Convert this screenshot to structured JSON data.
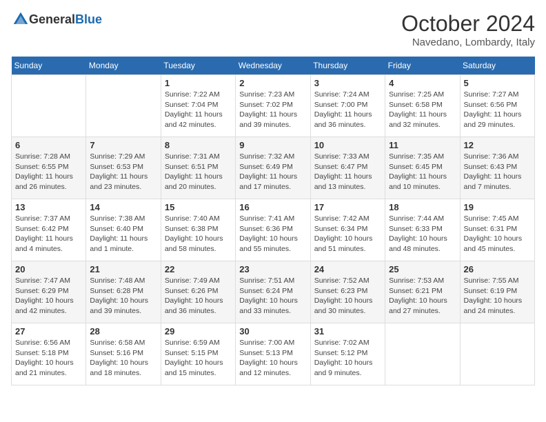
{
  "header": {
    "logo_general": "General",
    "logo_blue": "Blue",
    "month": "October 2024",
    "location": "Navedano, Lombardy, Italy"
  },
  "days_of_week": [
    "Sunday",
    "Monday",
    "Tuesday",
    "Wednesday",
    "Thursday",
    "Friday",
    "Saturday"
  ],
  "weeks": [
    [
      {
        "day": "",
        "info": ""
      },
      {
        "day": "",
        "info": ""
      },
      {
        "day": "1",
        "info": "Sunrise: 7:22 AM\nSunset: 7:04 PM\nDaylight: 11 hours and 42 minutes."
      },
      {
        "day": "2",
        "info": "Sunrise: 7:23 AM\nSunset: 7:02 PM\nDaylight: 11 hours and 39 minutes."
      },
      {
        "day": "3",
        "info": "Sunrise: 7:24 AM\nSunset: 7:00 PM\nDaylight: 11 hours and 36 minutes."
      },
      {
        "day": "4",
        "info": "Sunrise: 7:25 AM\nSunset: 6:58 PM\nDaylight: 11 hours and 32 minutes."
      },
      {
        "day": "5",
        "info": "Sunrise: 7:27 AM\nSunset: 6:56 PM\nDaylight: 11 hours and 29 minutes."
      }
    ],
    [
      {
        "day": "6",
        "info": "Sunrise: 7:28 AM\nSunset: 6:55 PM\nDaylight: 11 hours and 26 minutes."
      },
      {
        "day": "7",
        "info": "Sunrise: 7:29 AM\nSunset: 6:53 PM\nDaylight: 11 hours and 23 minutes."
      },
      {
        "day": "8",
        "info": "Sunrise: 7:31 AM\nSunset: 6:51 PM\nDaylight: 11 hours and 20 minutes."
      },
      {
        "day": "9",
        "info": "Sunrise: 7:32 AM\nSunset: 6:49 PM\nDaylight: 11 hours and 17 minutes."
      },
      {
        "day": "10",
        "info": "Sunrise: 7:33 AM\nSunset: 6:47 PM\nDaylight: 11 hours and 13 minutes."
      },
      {
        "day": "11",
        "info": "Sunrise: 7:35 AM\nSunset: 6:45 PM\nDaylight: 11 hours and 10 minutes."
      },
      {
        "day": "12",
        "info": "Sunrise: 7:36 AM\nSunset: 6:43 PM\nDaylight: 11 hours and 7 minutes."
      }
    ],
    [
      {
        "day": "13",
        "info": "Sunrise: 7:37 AM\nSunset: 6:42 PM\nDaylight: 11 hours and 4 minutes."
      },
      {
        "day": "14",
        "info": "Sunrise: 7:38 AM\nSunset: 6:40 PM\nDaylight: 11 hours and 1 minute."
      },
      {
        "day": "15",
        "info": "Sunrise: 7:40 AM\nSunset: 6:38 PM\nDaylight: 10 hours and 58 minutes."
      },
      {
        "day": "16",
        "info": "Sunrise: 7:41 AM\nSunset: 6:36 PM\nDaylight: 10 hours and 55 minutes."
      },
      {
        "day": "17",
        "info": "Sunrise: 7:42 AM\nSunset: 6:34 PM\nDaylight: 10 hours and 51 minutes."
      },
      {
        "day": "18",
        "info": "Sunrise: 7:44 AM\nSunset: 6:33 PM\nDaylight: 10 hours and 48 minutes."
      },
      {
        "day": "19",
        "info": "Sunrise: 7:45 AM\nSunset: 6:31 PM\nDaylight: 10 hours and 45 minutes."
      }
    ],
    [
      {
        "day": "20",
        "info": "Sunrise: 7:47 AM\nSunset: 6:29 PM\nDaylight: 10 hours and 42 minutes."
      },
      {
        "day": "21",
        "info": "Sunrise: 7:48 AM\nSunset: 6:28 PM\nDaylight: 10 hours and 39 minutes."
      },
      {
        "day": "22",
        "info": "Sunrise: 7:49 AM\nSunset: 6:26 PM\nDaylight: 10 hours and 36 minutes."
      },
      {
        "day": "23",
        "info": "Sunrise: 7:51 AM\nSunset: 6:24 PM\nDaylight: 10 hours and 33 minutes."
      },
      {
        "day": "24",
        "info": "Sunrise: 7:52 AM\nSunset: 6:23 PM\nDaylight: 10 hours and 30 minutes."
      },
      {
        "day": "25",
        "info": "Sunrise: 7:53 AM\nSunset: 6:21 PM\nDaylight: 10 hours and 27 minutes."
      },
      {
        "day": "26",
        "info": "Sunrise: 7:55 AM\nSunset: 6:19 PM\nDaylight: 10 hours and 24 minutes."
      }
    ],
    [
      {
        "day": "27",
        "info": "Sunrise: 6:56 AM\nSunset: 5:18 PM\nDaylight: 10 hours and 21 minutes."
      },
      {
        "day": "28",
        "info": "Sunrise: 6:58 AM\nSunset: 5:16 PM\nDaylight: 10 hours and 18 minutes."
      },
      {
        "day": "29",
        "info": "Sunrise: 6:59 AM\nSunset: 5:15 PM\nDaylight: 10 hours and 15 minutes."
      },
      {
        "day": "30",
        "info": "Sunrise: 7:00 AM\nSunset: 5:13 PM\nDaylight: 10 hours and 12 minutes."
      },
      {
        "day": "31",
        "info": "Sunrise: 7:02 AM\nSunset: 5:12 PM\nDaylight: 10 hours and 9 minutes."
      },
      {
        "day": "",
        "info": ""
      },
      {
        "day": "",
        "info": ""
      }
    ]
  ]
}
